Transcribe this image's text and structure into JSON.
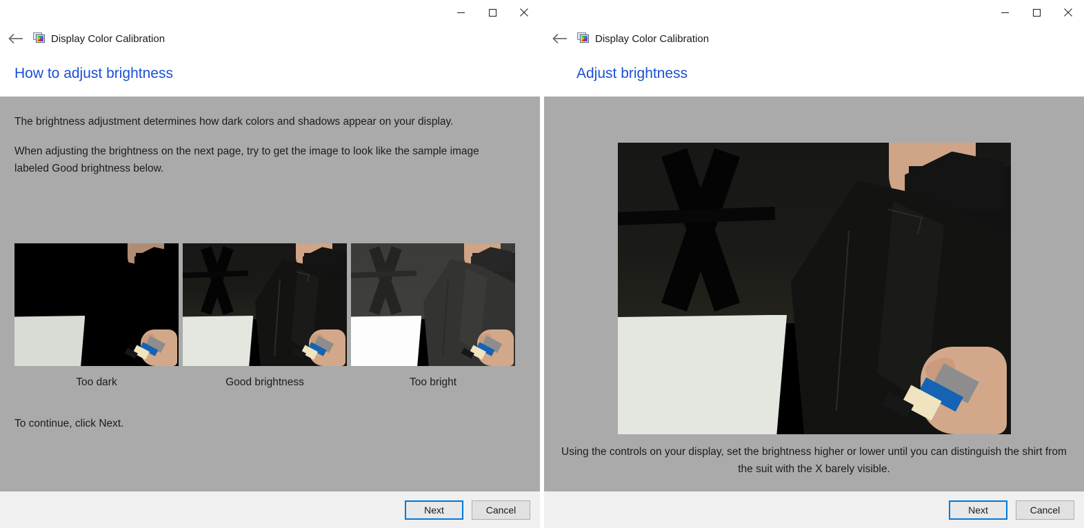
{
  "app": {
    "name": "Display Color Calibration",
    "icon": "display-color-icon",
    "back_icon": "back-arrow-icon"
  },
  "window_controls": {
    "minimize": "minimize-icon",
    "maximize": "maximize-icon",
    "close": "close-icon"
  },
  "colors": {
    "heading": "#1a4fd6",
    "content_bg": "#aaaaaa",
    "footer_bg": "#f0f0f0",
    "accent_focus": "#0078d7"
  },
  "left_window": {
    "heading": "How to adjust brightness",
    "paragraphs": [
      "The brightness adjustment determines how dark colors and shadows appear on your display.",
      "When adjusting the brightness on the next page, try to get the image to look like the sample image labeled Good brightness below."
    ],
    "samples": [
      {
        "label": "Too dark",
        "variant": "too-dark"
      },
      {
        "label": "Good brightness",
        "variant": "good"
      },
      {
        "label": "Too bright",
        "variant": "too-bright"
      }
    ],
    "continue_text": "To continue, click Next.",
    "buttons": {
      "next": "Next",
      "cancel": "Cancel"
    }
  },
  "right_window": {
    "heading": "Adjust brightness",
    "caption": "Using the controls on your display, set the brightness higher or lower until you can distinguish the shirt from the suit with the X barely visible.",
    "buttons": {
      "next": "Next",
      "cancel": "Cancel"
    }
  }
}
